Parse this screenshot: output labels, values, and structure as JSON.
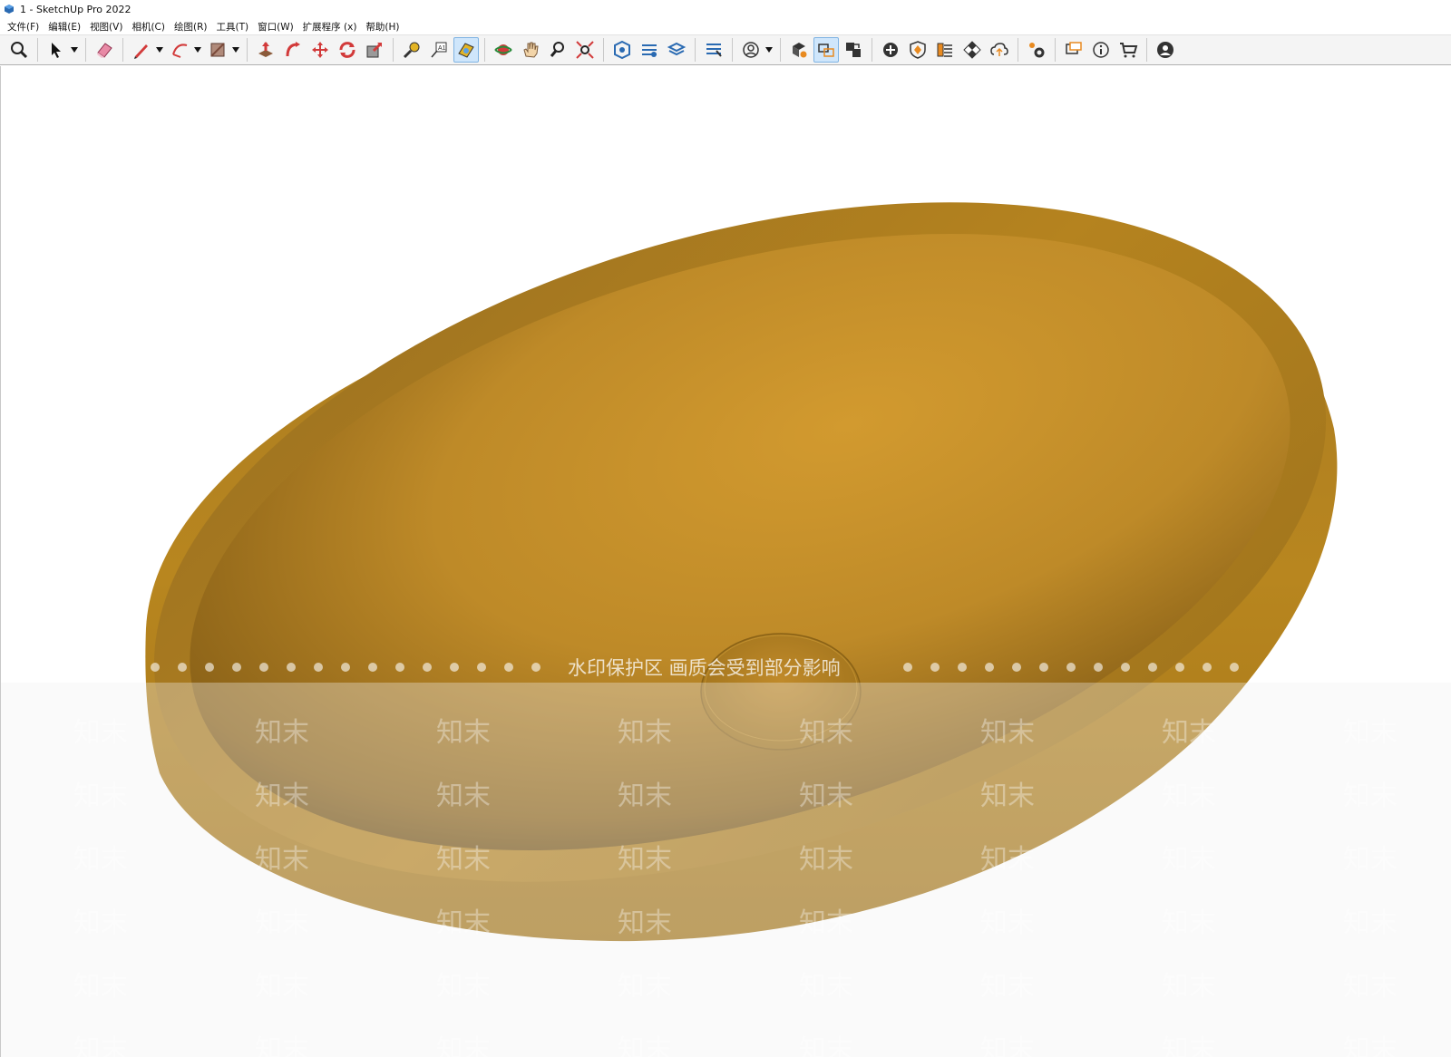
{
  "window": {
    "title": "1 - SketchUp Pro 2022"
  },
  "menu": [
    "文件(F)",
    "编辑(E)",
    "视图(V)",
    "相机(C)",
    "绘图(R)",
    "工具(T)",
    "窗口(W)",
    "扩展程序 (x)",
    "帮助(H)"
  ],
  "toolbar": {
    "icons": [
      "zoom-icon",
      "select-icon",
      "eraser-icon",
      "pencil-icon",
      "arc-icon",
      "paint-bucket-icon",
      "push-pull-icon",
      "follow-me-icon",
      "move-icon",
      "rotate-icon",
      "scale-icon",
      "tape-measure-icon",
      "text-icon",
      "section-plane-icon",
      "orbit-icon",
      "pan-icon",
      "zoom-window-icon",
      "zoom-extents-icon",
      "warehouse-icon",
      "layers-icon",
      "scenes-icon",
      "outliner-icon",
      "user-icon",
      "components-icon",
      "dynamic-components-icon",
      "export-icon",
      "add-icon",
      "extension-warehouse-icon",
      "materials-icon",
      "checker-icon",
      "cloud-upload-icon",
      "settings-icon",
      "message-icon",
      "info-icon",
      "cart-icon",
      "account-icon"
    ],
    "active": "section-plane-icon"
  },
  "viewport": {
    "model": "basin",
    "material_color": "#c48f2c",
    "watermark_text": "水印保护区  画质会受到部分影响",
    "watermark_brand": "知末"
  }
}
